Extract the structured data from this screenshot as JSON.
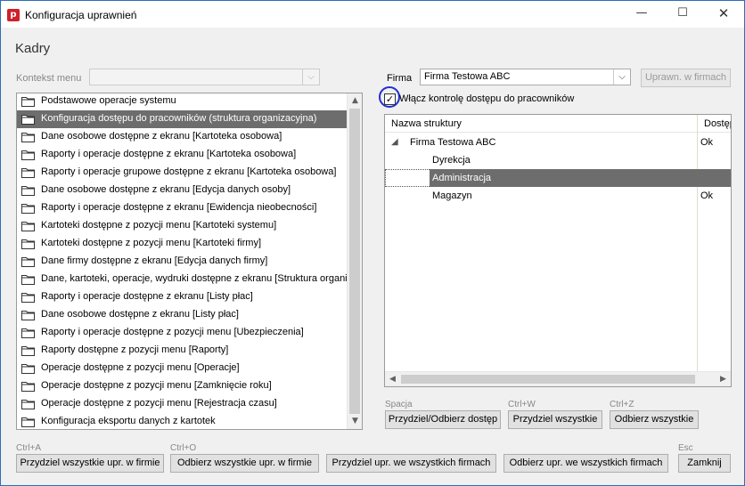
{
  "window": {
    "title": "Konfiguracja uprawnień",
    "app_icon": "p",
    "minimize": "—",
    "maximize": "☐",
    "close": "✕"
  },
  "section_title": "Kadry",
  "context_menu": {
    "label": "Kontekst menu",
    "value": ""
  },
  "firm": {
    "label": "Firma",
    "value": "Firma Testowa ABC",
    "button": "Uprawn. w firmach"
  },
  "menu_list": {
    "items": [
      "Podstawowe operacje systemu",
      "Konfiguracja dostępu do pracowników (struktura organizacyjna)",
      "Dane osobowe dostępne z ekranu [Kartoteka osobowa]",
      "Raporty i operacje dostępne z ekranu [Kartoteka osobowa]",
      "Raporty i operacje grupowe dostępne z ekranu [Kartoteka osobowa]",
      "Dane osobowe dostępne z ekranu [Edycja danych osoby]",
      "Raporty i operacje dostępne z ekranu [Ewidencja nieobecności]",
      "Kartoteki dostępne z pozycji menu [Kartoteki systemu]",
      "Kartoteki dostępne z pozycji menu [Kartoteki firmy]",
      "Dane firmy dostępne z ekranu [Edycja danych firmy]",
      "Dane, kartoteki, operacje, wydruki dostępne z ekranu [Struktura organizacyjna]",
      "Raporty i operacje dostępne z ekranu [Listy płac]",
      "Dane osobowe dostępne z ekranu [Listy płac]",
      "Raporty i operacje dostępne z pozycji menu [Ubezpieczenia]",
      "Raporty dostępne z pozycji menu [Raporty]",
      "Operacje dostępne z pozycji menu [Operacje]",
      "Operacje dostępne z pozycji menu [Zamknięcie roku]",
      "Operacje dostępne z pozycji menu [Rejestracja czasu]",
      "Konfiguracja eksportu danych z kartotek"
    ],
    "selected_index": 1
  },
  "access_control": {
    "checked": true,
    "check_mark": "✓",
    "label": "Włącz kontrolę dostępu do pracowników"
  },
  "tree": {
    "col_name": "Nazwa struktury",
    "col_access": "Dostęp",
    "expander": "◢",
    "rows": [
      {
        "name": "Firma Testowa ABC",
        "status": "Ok",
        "level": 0
      },
      {
        "name": "Dyrekcja",
        "status": "",
        "level": 1
      },
      {
        "name": "Administracja",
        "status": "",
        "level": 1
      },
      {
        "name": "Magazyn",
        "status": "Ok",
        "level": 1
      }
    ],
    "selected_index": 2
  },
  "tree_buttons": [
    {
      "shortcut": "Spacja",
      "label": "Przydziel/Odbierz dostęp"
    },
    {
      "shortcut": "Ctrl+W",
      "label": "Przydziel wszystkie"
    },
    {
      "shortcut": "Ctrl+Z",
      "label": "Odbierz wszystkie"
    }
  ],
  "bottom_buttons": [
    {
      "shortcut": "Ctrl+A",
      "label": "Przydziel wszystkie upr. w firmie"
    },
    {
      "shortcut": "Ctrl+O",
      "label": "Odbierz wszystkie upr. w firmie"
    },
    {
      "shortcut": "",
      "label": "Przydziel upr. we wszystkich firmach"
    },
    {
      "shortcut": "",
      "label": "Odbierz upr. we wszystkich firmach"
    },
    {
      "shortcut": "Esc",
      "label": "Zamknij"
    }
  ],
  "icons": {
    "scroll_up": "▲",
    "scroll_down": "▼",
    "scroll_left": "◀",
    "scroll_right": "▶",
    "dropdown": "⌵"
  }
}
